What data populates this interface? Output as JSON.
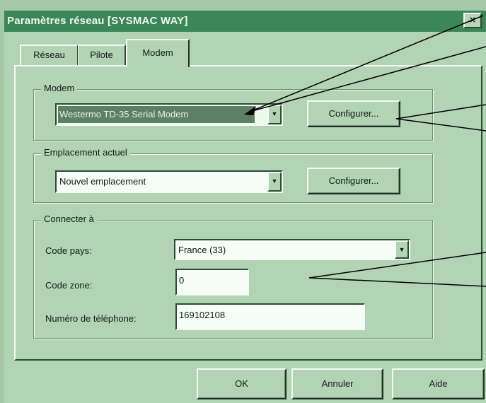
{
  "window": {
    "title": "Paramètres réseau [SYSMAC WAY]",
    "close_glyph": "×"
  },
  "tabs": [
    {
      "label": "Réseau"
    },
    {
      "label": "Pilote"
    },
    {
      "label": "Modem",
      "selected": true
    }
  ],
  "modem_group": {
    "label": "Modem",
    "selected_value": "Westermo TD-35 Serial Modem",
    "configure_label": "Configurer..."
  },
  "location_group": {
    "label": "Emplacement actuel",
    "selected_value": "Nouvel emplacement",
    "configure_label": "Configurer..."
  },
  "connect_group": {
    "label": "Connecter à",
    "country_label": "Code pays:",
    "country_value": "France (33)",
    "zone_label": "Code zone:",
    "zone_value": "0",
    "phone_label": "Numéro de téléphone:",
    "phone_value": "169102108"
  },
  "footer": {
    "ok_label": "OK",
    "cancel_label": "Annuler",
    "help_label": "Aide"
  },
  "icons": {
    "dropdown": "triangle-down",
    "close": "close-x"
  },
  "colors": {
    "background": "#a6c8a8",
    "titlebar": "#3c8757",
    "face": "#b3d3b5",
    "selection": "#5d7f63"
  }
}
